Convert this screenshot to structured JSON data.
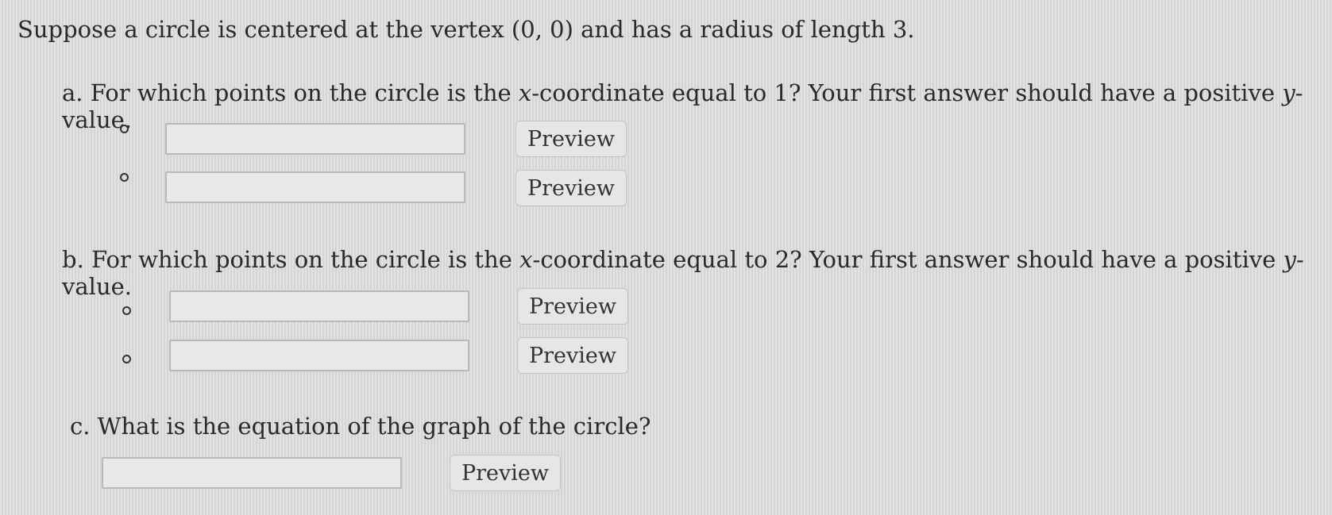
{
  "intro": "Suppose a circle is centered at the vertex (0, 0) and has a radius of length 3.",
  "part_a": {
    "prefix": "a. For which points on the circle is the ",
    "var1": "x",
    "middle": "-coordinate equal to 1? Your first answer should have a positive ",
    "var2": "y",
    "suffix": "-value."
  },
  "part_b": {
    "prefix": "b. For which points on the circle is the ",
    "var1": "x",
    "middle": "-coordinate equal to 2? Your first answer should have a positive ",
    "var2": "y",
    "suffix": "-value."
  },
  "part_c": {
    "text": "c. What is the equation of the graph of the circle?"
  },
  "preview_label": "Preview",
  "answers": {
    "a1": "",
    "a2": "",
    "b1": "",
    "b2": "",
    "c": ""
  }
}
